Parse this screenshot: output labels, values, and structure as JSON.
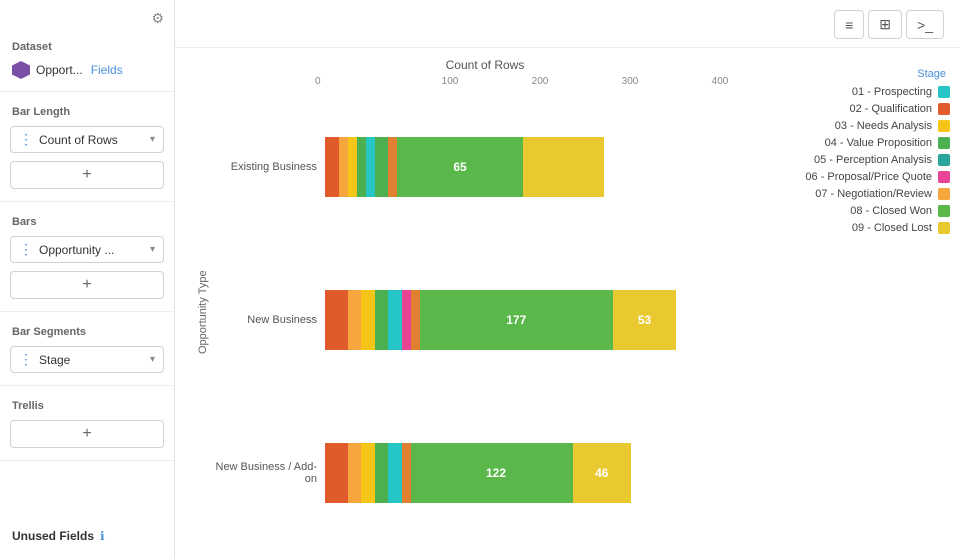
{
  "sidebar": {
    "dataset_label": "Dataset",
    "dataset_name": "Opport...",
    "dataset_fields": "Fields",
    "bar_length_label": "Bar Length",
    "bar_length_value": "Count of Rows",
    "bars_label": "Bars",
    "bars_value": "Opportunity ...",
    "bar_segments_label": "Bar Segments",
    "bar_segments_value": "Stage",
    "trellis_label": "Trellis",
    "unused_fields_label": "Unused Fields"
  },
  "toolbar": {
    "btn1": "≡",
    "btn2": "⊞",
    "btn3": ">_"
  },
  "chart": {
    "title": "Count of Rows",
    "y_axis_label": "Opportunity Type",
    "x_ticks": [
      "0",
      "100",
      "200",
      "300",
      "400"
    ],
    "bars": [
      {
        "label": "Existing Business",
        "segments": [
          {
            "color": "#e05a2b",
            "width_pct": 3
          },
          {
            "color": "#f7a63e",
            "width_pct": 2
          },
          {
            "color": "#f5c518",
            "width_pct": 2
          },
          {
            "color": "#4caf50",
            "width_pct": 2
          },
          {
            "color": "#26c6c6",
            "width_pct": 2
          },
          {
            "color": "#4caf50",
            "width_pct": 3
          },
          {
            "color": "#e08030",
            "width_pct": 2
          },
          {
            "color": "#5ab84b",
            "width_pct": 28,
            "label": "65"
          },
          {
            "color": "#e8c930",
            "width_pct": 18
          }
        ]
      },
      {
        "label": "New Business",
        "segments": [
          {
            "color": "#e05a2b",
            "width_pct": 5
          },
          {
            "color": "#f7a63e",
            "width_pct": 3
          },
          {
            "color": "#f5c518",
            "width_pct": 3
          },
          {
            "color": "#4caf50",
            "width_pct": 3
          },
          {
            "color": "#26c6c6",
            "width_pct": 3
          },
          {
            "color": "#e84393",
            "width_pct": 2
          },
          {
            "color": "#e08030",
            "width_pct": 2
          },
          {
            "color": "#5ab84b",
            "width_pct": 43,
            "label": "177"
          },
          {
            "color": "#e8c930",
            "width_pct": 14,
            "label": "53"
          }
        ]
      },
      {
        "label": "New Business / Add-on",
        "segments": [
          {
            "color": "#e05a2b",
            "width_pct": 5
          },
          {
            "color": "#f7a63e",
            "width_pct": 3
          },
          {
            "color": "#f5c518",
            "width_pct": 3
          },
          {
            "color": "#4caf50",
            "width_pct": 3
          },
          {
            "color": "#26c6c6",
            "width_pct": 3
          },
          {
            "color": "#e08030",
            "width_pct": 2
          },
          {
            "color": "#5ab84b",
            "width_pct": 2
          },
          {
            "color": "#5ab84b",
            "width_pct": 34,
            "label": "122"
          },
          {
            "color": "#e8c930",
            "width_pct": 13,
            "label": "46"
          }
        ]
      }
    ]
  },
  "legend": {
    "title": "Stage",
    "items": [
      {
        "label": "01 - Prospecting",
        "color": "#26c6c6"
      },
      {
        "label": "02 - Qualification",
        "color": "#e05a2b"
      },
      {
        "label": "03 - Needs Analysis",
        "color": "#f5c518"
      },
      {
        "label": "04 - Value Proposition",
        "color": "#4caf50"
      },
      {
        "label": "05 - Perception Analysis",
        "color": "#26a69a"
      },
      {
        "label": "06 - Proposal/Price Quote",
        "color": "#e84393"
      },
      {
        "label": "07 - Negotiation/Review",
        "color": "#f7a63e"
      },
      {
        "label": "08 - Closed Won",
        "color": "#5ab84b"
      },
      {
        "label": "09 - Closed Lost",
        "color": "#e8c930"
      }
    ]
  }
}
